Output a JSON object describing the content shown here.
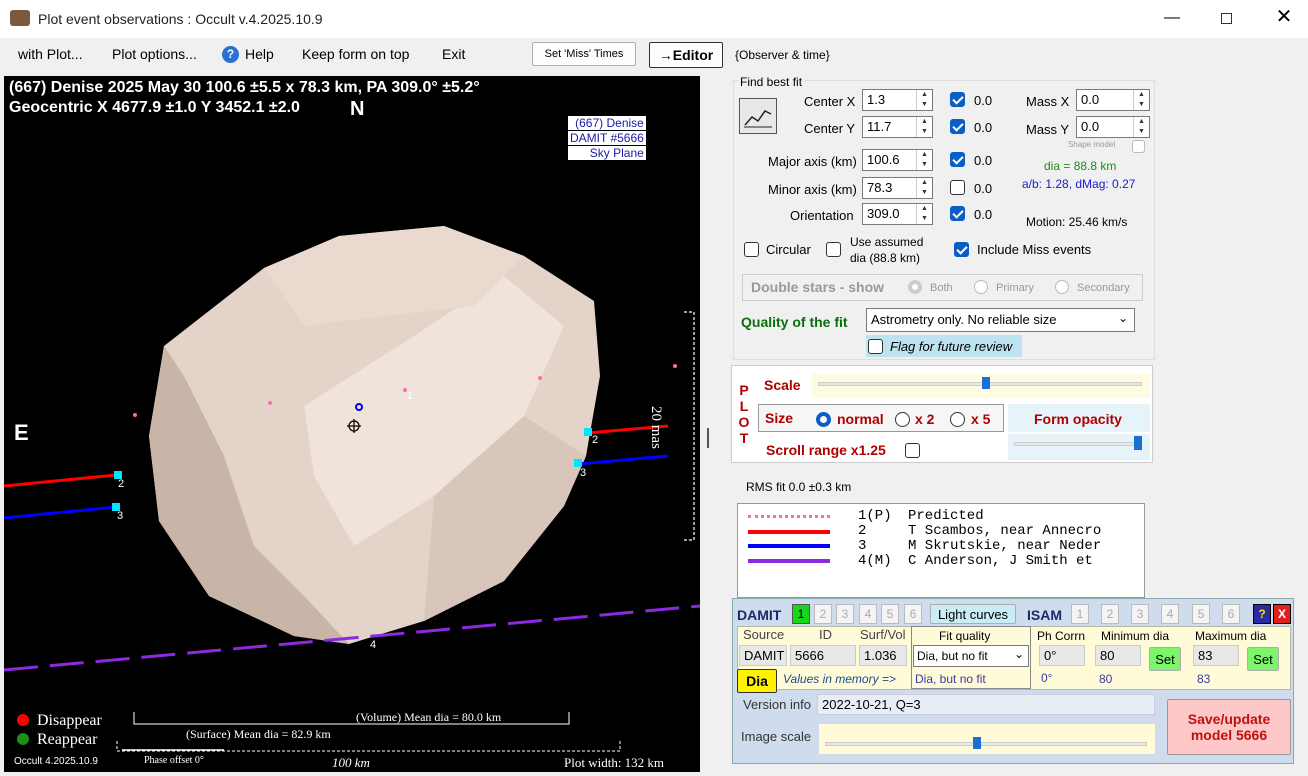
{
  "window": {
    "title": "Plot event observations : Occult v.4.2025.10.9"
  },
  "menu": {
    "with_plot": "with Plot...",
    "plot_options": "Plot options...",
    "help": "Help",
    "keep_on_top": "Keep form on top",
    "exit": "Exit",
    "set_miss_times": "Set 'Miss' Times",
    "editor": "→Editor",
    "observer_time": "{Observer & time}"
  },
  "plot": {
    "header_line1": "(667) Denise  2025 May 30   100.6 ±5.5 x 78.3 km, PA 309.0° ±5.2°",
    "header_line2": "Geocentric  X  4677.9 ±1.0  Y  3452.1 ±2.0",
    "north": "N",
    "east": "E",
    "model_label": [
      "(667) Denise",
      "DAMIT #5666",
      "Sky Plane"
    ],
    "scale_label": "20 mas",
    "chord_labels": [
      "1",
      "2",
      "2",
      "3",
      "3",
      "4"
    ],
    "legend_disappear": "Disappear",
    "legend_reappear": "Reappear",
    "volume_dia": "(Volume) Mean dia = 80.0 km",
    "surface_dia": "(Surface) Mean dia = 82.9 km",
    "version": "Occult 4.2025.10.9",
    "phase_offset": "Phase offset 0°",
    "scale_100km": "100 km",
    "plot_width": "Plot width: 132 km",
    "colors": {
      "disappear": "#ff0000",
      "reappear": "#1a8f1a",
      "chord2": "#ff0000",
      "chord3": "#0000ff",
      "chord4": "#8a2be2",
      "predicted": "#ff69b4"
    }
  },
  "fit": {
    "section_title": "Find best fit",
    "center_x": {
      "label": "Center X",
      "value": "1.3",
      "offset": "0.0"
    },
    "center_y": {
      "label": "Center Y",
      "value": "11.7",
      "offset": "0.0"
    },
    "major_axis": {
      "label": "Major axis (km)",
      "value": "100.6",
      "offset": "0.0"
    },
    "minor_axis": {
      "label": "Minor axis (km)",
      "value": "78.3",
      "offset": "0.0"
    },
    "orientation": {
      "label": "Orientation",
      "value": "309.0",
      "offset": "0.0"
    },
    "mass_x": {
      "label": "Mass X",
      "value": "0.0"
    },
    "mass_y": {
      "label": "Mass Y",
      "value": "0.0"
    },
    "shape_model": "Shape model",
    "dia": "dia = 88.8 km",
    "ab_dmag": "a/b: 1.28, dMag: 0.27",
    "motion": "Motion: 25.46 km/s",
    "circular": "Circular",
    "use_assumed": "Use assumed",
    "use_assumed2": "dia (88.8 km)",
    "include_miss": "Include Miss events",
    "double_stars": "Double stars - show",
    "both": "Both",
    "primary": "Primary",
    "secondary": "Secondary",
    "quality_label": "Quality of the fit",
    "quality_value": "Astrometry only. No reliable size",
    "flag_review": "Flag for future review"
  },
  "plotctl": {
    "side": [
      "P",
      "L",
      "O",
      "T"
    ],
    "scale": "Scale",
    "size": "Size",
    "normal": "normal",
    "x2": "x 2",
    "x5": "x 5",
    "form_opacity": "Form opacity",
    "scroll_range": "Scroll range x1.25"
  },
  "rms": "RMS fit 0.0 ±0.3 km",
  "legend": [
    {
      "num": "1(P)",
      "name": "Predicted"
    },
    {
      "num": "2",
      "name": "T Scambos, near Annecro"
    },
    {
      "num": "3",
      "name": "M Skrutskie, near Neder"
    },
    {
      "num": "4(M)",
      "name": "C Anderson, J Smith et"
    }
  ],
  "damit": {
    "title": "DAMIT",
    "nums": [
      "1",
      "2",
      "3",
      "4",
      "5",
      "6"
    ],
    "light_curves": "Light curves",
    "isam": "ISAM",
    "isam_nums": [
      "1",
      "2",
      "3",
      "4",
      "5",
      "6"
    ],
    "help": "?",
    "close": "X",
    "hdr_source": "Source",
    "hdr_id": "ID",
    "hdr_surfvol": "Surf/Vol",
    "hdr_fit": "Fit quality",
    "hdr_phcorr": "Ph Corrn",
    "hdr_min": "Minimum dia",
    "hdr_max": "Maximum dia",
    "source": "DAMIT",
    "id": "5666",
    "surfvol": "1.036",
    "fit_quality": "Dia, but no fit",
    "ph_corr": "0°",
    "min_dia": "80",
    "max_dia": "83",
    "set": "Set",
    "dia_btn": "Dia",
    "mem_label": "Values in memory =>",
    "mem_fit": "Dia, but no fit",
    "mem_ph": "0°",
    "mem_min": "80",
    "mem_max": "83",
    "version_label": "Version info",
    "version_value": "2022-10-21, Q=3",
    "image_scale": "Image scale",
    "save": "Save/update model 5666"
  }
}
